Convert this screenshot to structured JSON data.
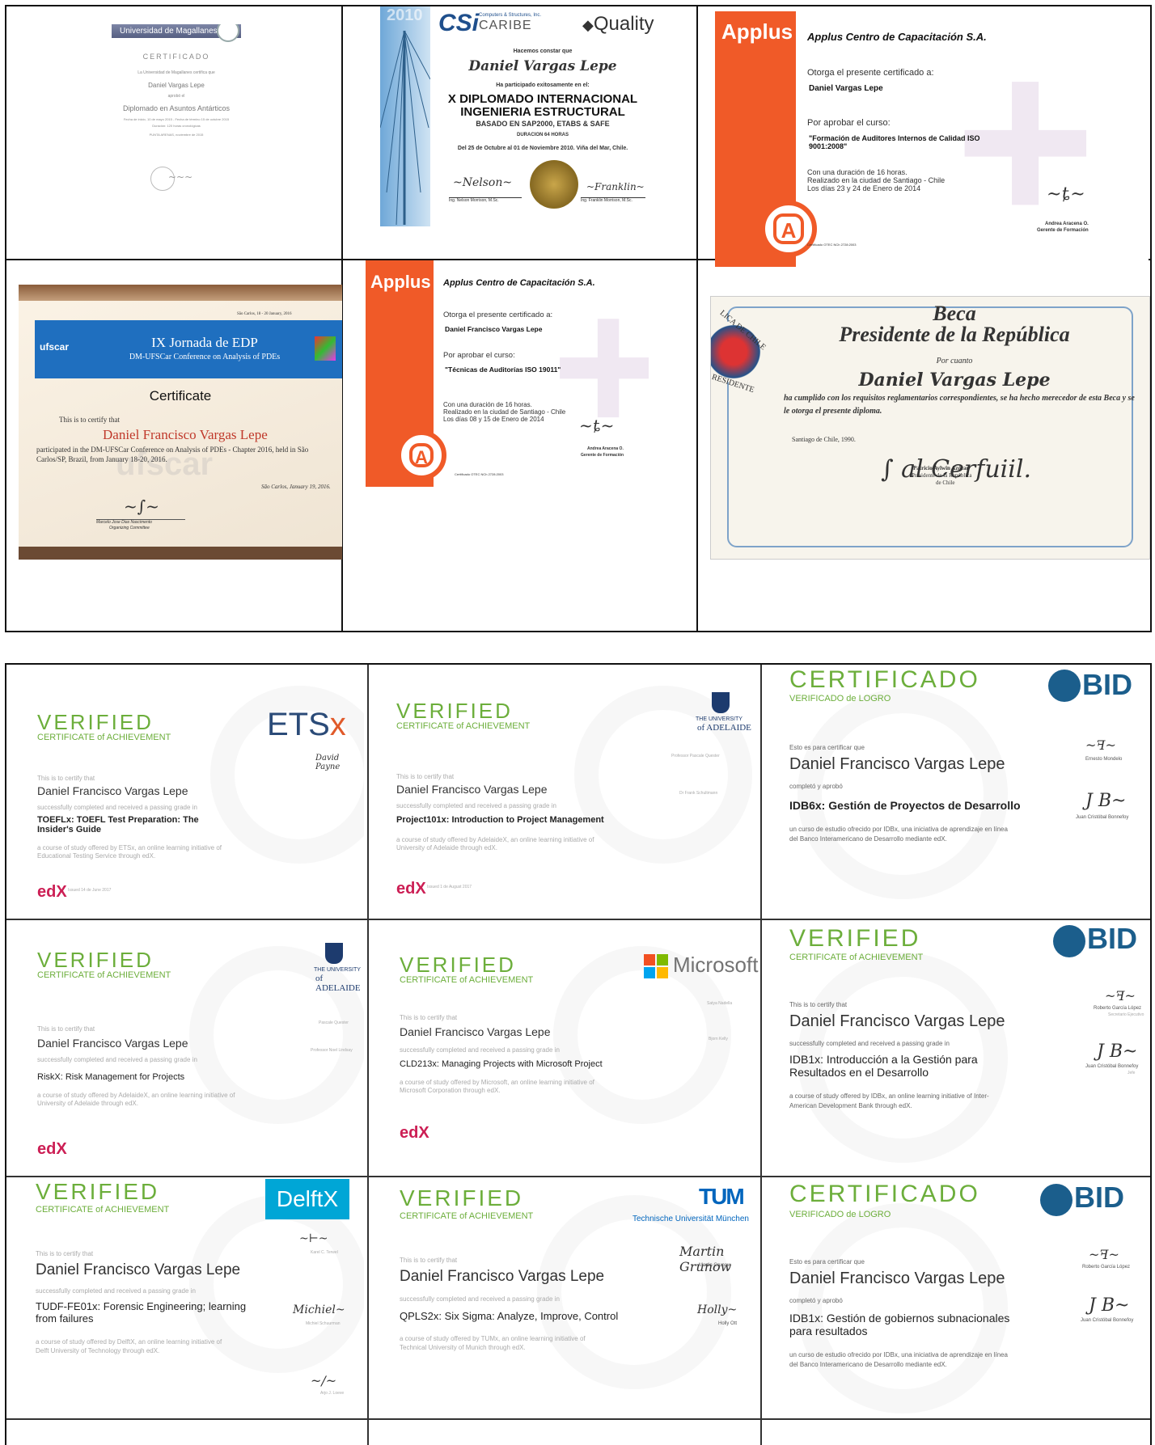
{
  "top": {
    "magallanes": {
      "bar": "Universidad de Magallanes",
      "title": "CERTIFICADO",
      "line1": "La Universidad de Magallanes certifica que",
      "name": "Daniel Vargas Lepe",
      "line2": "aprobó el",
      "program": "Diplomado en Asuntos Antárticos",
      "dates": "Fecha de inicio, 10 de mayo 2015 - Fecha de término 15 de octubre 2015",
      "duration": "Duración: 120 horas cronológicas",
      "place": "PUNTA ARENAS, noviembre de 2015"
    },
    "csi": {
      "year": "2010",
      "brand": "CSi",
      "company": "Computers & Structures, Inc.",
      "caribe": "CARIBE",
      "quality": "Quality",
      "line1": "Hacemos constar que",
      "name": "Daniel Vargas Lepe",
      "line2": "Ha participado exitosamente en el:",
      "title1": "X DIPLOMADO INTERNACIONAL",
      "title2": "INGENIERIA ESTRUCTURAL",
      "sub": "BASADO EN SAP2000, ETABS & SAFE",
      "hours": "DURACION 64 HORAS",
      "dates": "Del 25 de Octubre al 01 de Noviembre 2010. Viña del Mar, Chile.",
      "sig1": "Ing. Nelson Morrison, M.Sc.",
      "sig2": "Ing. Franklin Morrison, M.Sc."
    },
    "applus1": {
      "logo": "Applus",
      "header": "Applus Centro de Capacitación S.A.",
      "grant": "Otorga el presente certificado a:",
      "name": "Daniel Vargas Lepe",
      "approve": "Por aprobar el curso:",
      "course": "\"Formación de Auditores Internos de Calidad ISO 9001:2008\"",
      "dur1": "Con una duración de 16 horas.",
      "dur2": "Realizado en la ciudad de Santiago - Chile",
      "dur3": "Los días 23 y 24 de Enero de 2014",
      "signer": "Andrea Aracena O.",
      "role": "Gerente de Formación",
      "cert": "Certificado OTEC NCh 2728:2003"
    },
    "ufscar": {
      "date": "São Carlos, 18 - 20 January, 2016",
      "logo": "ufscar",
      "title1": "IX Jornada de EDP",
      "title2": "DM-UFSCar Conference on Analysis of PDEs",
      "cert": "Certificate",
      "line1": "This is to certify that",
      "name": "Daniel Francisco Vargas Lepe",
      "body": "participated in the DM-UFSCar Conference on Analysis of PDEs - Chapter 2016, held in São Carlos/SP, Brazil, from January 18-20, 2016.",
      "place": "São Carlos, January 19, 2016.",
      "signer": "Marcelo Jose Dias Nascimento",
      "role": "Organizing Committee"
    },
    "applus2": {
      "logo": "Applus",
      "header": "Applus Centro de Capacitación S.A.",
      "grant": "Otorga el presente certificado a:",
      "name": "Daniel Francisco Vargas Lepe",
      "approve": "Por aprobar el curso:",
      "course": "\"Técnicas de Auditorías ISO 19011\"",
      "dur1": "Con una duración de 16 horas.",
      "dur2": "Realizado en la ciudad de Santiago - Chile",
      "dur3": "Los días 08 y 15 de Enero de 2014",
      "signer": "Andrea Aracena O.",
      "role": "Gerente de Formación",
      "cert": "Certificado OTEC NCh 2728:2003"
    },
    "beca": {
      "arc1": "LICA DE CHILE",
      "arc2": "RESIDENTE",
      "title1": "Beca",
      "title2": "Presidente de la República",
      "por": "Por cuanto",
      "name": "Daniel Vargas Lepe",
      "body": "ha cumplido con los requisitos reglamentarios correspondientes, se ha hecho merecedor de esta Beca y se le otorga el presente diploma.",
      "place": "Santiago de Chile, 1990.",
      "signer": "Patricio Aylwin Azócar",
      "role1": "Presidente de la República",
      "role2": "de Chile"
    }
  },
  "edx": {
    "verified": "VERIFIED",
    "coa": "CERTIFICATE of ACHIEVEMENT",
    "certify": "This is to certify that",
    "completed": "successfully completed and received a passing grade in",
    "name": "Daniel Francisco Vargas Lepe",
    "edx": "edX",
    "etsx": {
      "logo": "ETSx",
      "course": "TOEFLx: TOEFL Test Preparation: The Insider's Guide",
      "desc": "a course of study offered by ETSx, an online learning initiative of Educational Testing Service through edX.",
      "sig": "David Payne",
      "date": "Issued 14 de June 2017"
    },
    "adelaide1": {
      "logo1": "THE UNIVERSITY",
      "logo2": "of ADELAIDE",
      "course": "Project101x: Introduction to Project Management",
      "desc": "a course of study offered by AdelaideX, an online learning initiative of University of Adelaide through edX.",
      "sig1": "Professor Pascale Quester",
      "sig2": "Dr Frank Schultmann",
      "date": "Issued 1 de August 2017"
    },
    "bid1": {
      "title": "CERTIFICADO",
      "sub": "VERIFICADO de LOGRO",
      "certify": "Esto es para certificar que",
      "completed": "completó y aprobó",
      "course": "IDB6x: Gestión de Proyectos de Desarrollo",
      "desc": "un curso de estudio ofrecido por IDBx, una iniciativa de aprendizaje en línea del Banco Interamericano de Desarrollo mediante edX.",
      "sig1": "Ernesto Mondelo",
      "sig2": "Juan Cristóbal Bonnefoy",
      "logo": "BID"
    },
    "adelaide2": {
      "logo1": "THE UNIVERSITY",
      "logo2": "of ADELAIDE",
      "course": "RiskX: Risk Management for Projects",
      "desc": "a course of study offered by AdelaideX, an online learning initiative of University of Adelaide through edX.",
      "sig1": "Pascale Quester",
      "sig2": "Professor Noel Lindsay"
    },
    "microsoft": {
      "logo": "Microsoft",
      "course": "CLD213x: Managing Projects with Microsoft Project",
      "desc": "a course of study offered by Microsoft, an online learning initiative of Microsoft Corporation through edX.",
      "sig1": "Satya Nadella",
      "sig2": "Bjorn Kelly"
    },
    "bid2": {
      "logo": "BID",
      "course": "IDB1x: Introducción a la Gestión para Resultados en el Desarrollo",
      "desc": "a course of study offered by IDBx, an online learning initiative of Inter-American Development Bank through edX.",
      "sig1": "Roberto García López",
      "sig1r": "Secretario Ejecutivo",
      "sig2": "Juan Cristóbal Bonnefoy",
      "sig2r": "Jefe"
    },
    "delft": {
      "logo": "DelftX",
      "course": "TUDF-FE01x: Forensic Engineering; learning from failures",
      "desc": "a course of study offered by DelftX, an online learning initiative of Delft University of Technology through edX.",
      "sig1": "Karel C. Terwel",
      "sig2": "Michiel Schuurman",
      "sig3": "Arjo J. Loeve"
    },
    "tum": {
      "logo": "TUM",
      "logo2": "Technische Universität München",
      "course": "QPLS2x: Six Sigma: Analyze, Improve, Control",
      "desc": "a course of study offered by TUMx, an online learning initiative of Technical University of Munich through edX.",
      "sig1": "Martin Grunow",
      "sig2": "Holly Ott"
    },
    "bid3": {
      "title": "CERTIFICADO",
      "sub": "VERIFICADO de LOGRO",
      "certify": "Esto es para certificar que",
      "completed": "completó y aprobó",
      "course": "IDB1x: Gestión de gobiernos subnacionales para resultados",
      "desc": "un curso de estudio ofrecido por IDBx, una iniciativa de aprendizaje en línea del Banco Interamericano de Desarrollo mediante edX.",
      "sig1": "Roberto García López",
      "sig2": "Juan Cristóbal Bonnefoy",
      "logo": "BID"
    }
  },
  "colors": {
    "edx_green": "#6cae3b",
    "applus_orange": "#f05a28",
    "bid_blue": "#1b5e8c",
    "edx_red": "#cc1e54",
    "delft_blue": "#00a6d6",
    "tum_blue": "#0065bd"
  }
}
